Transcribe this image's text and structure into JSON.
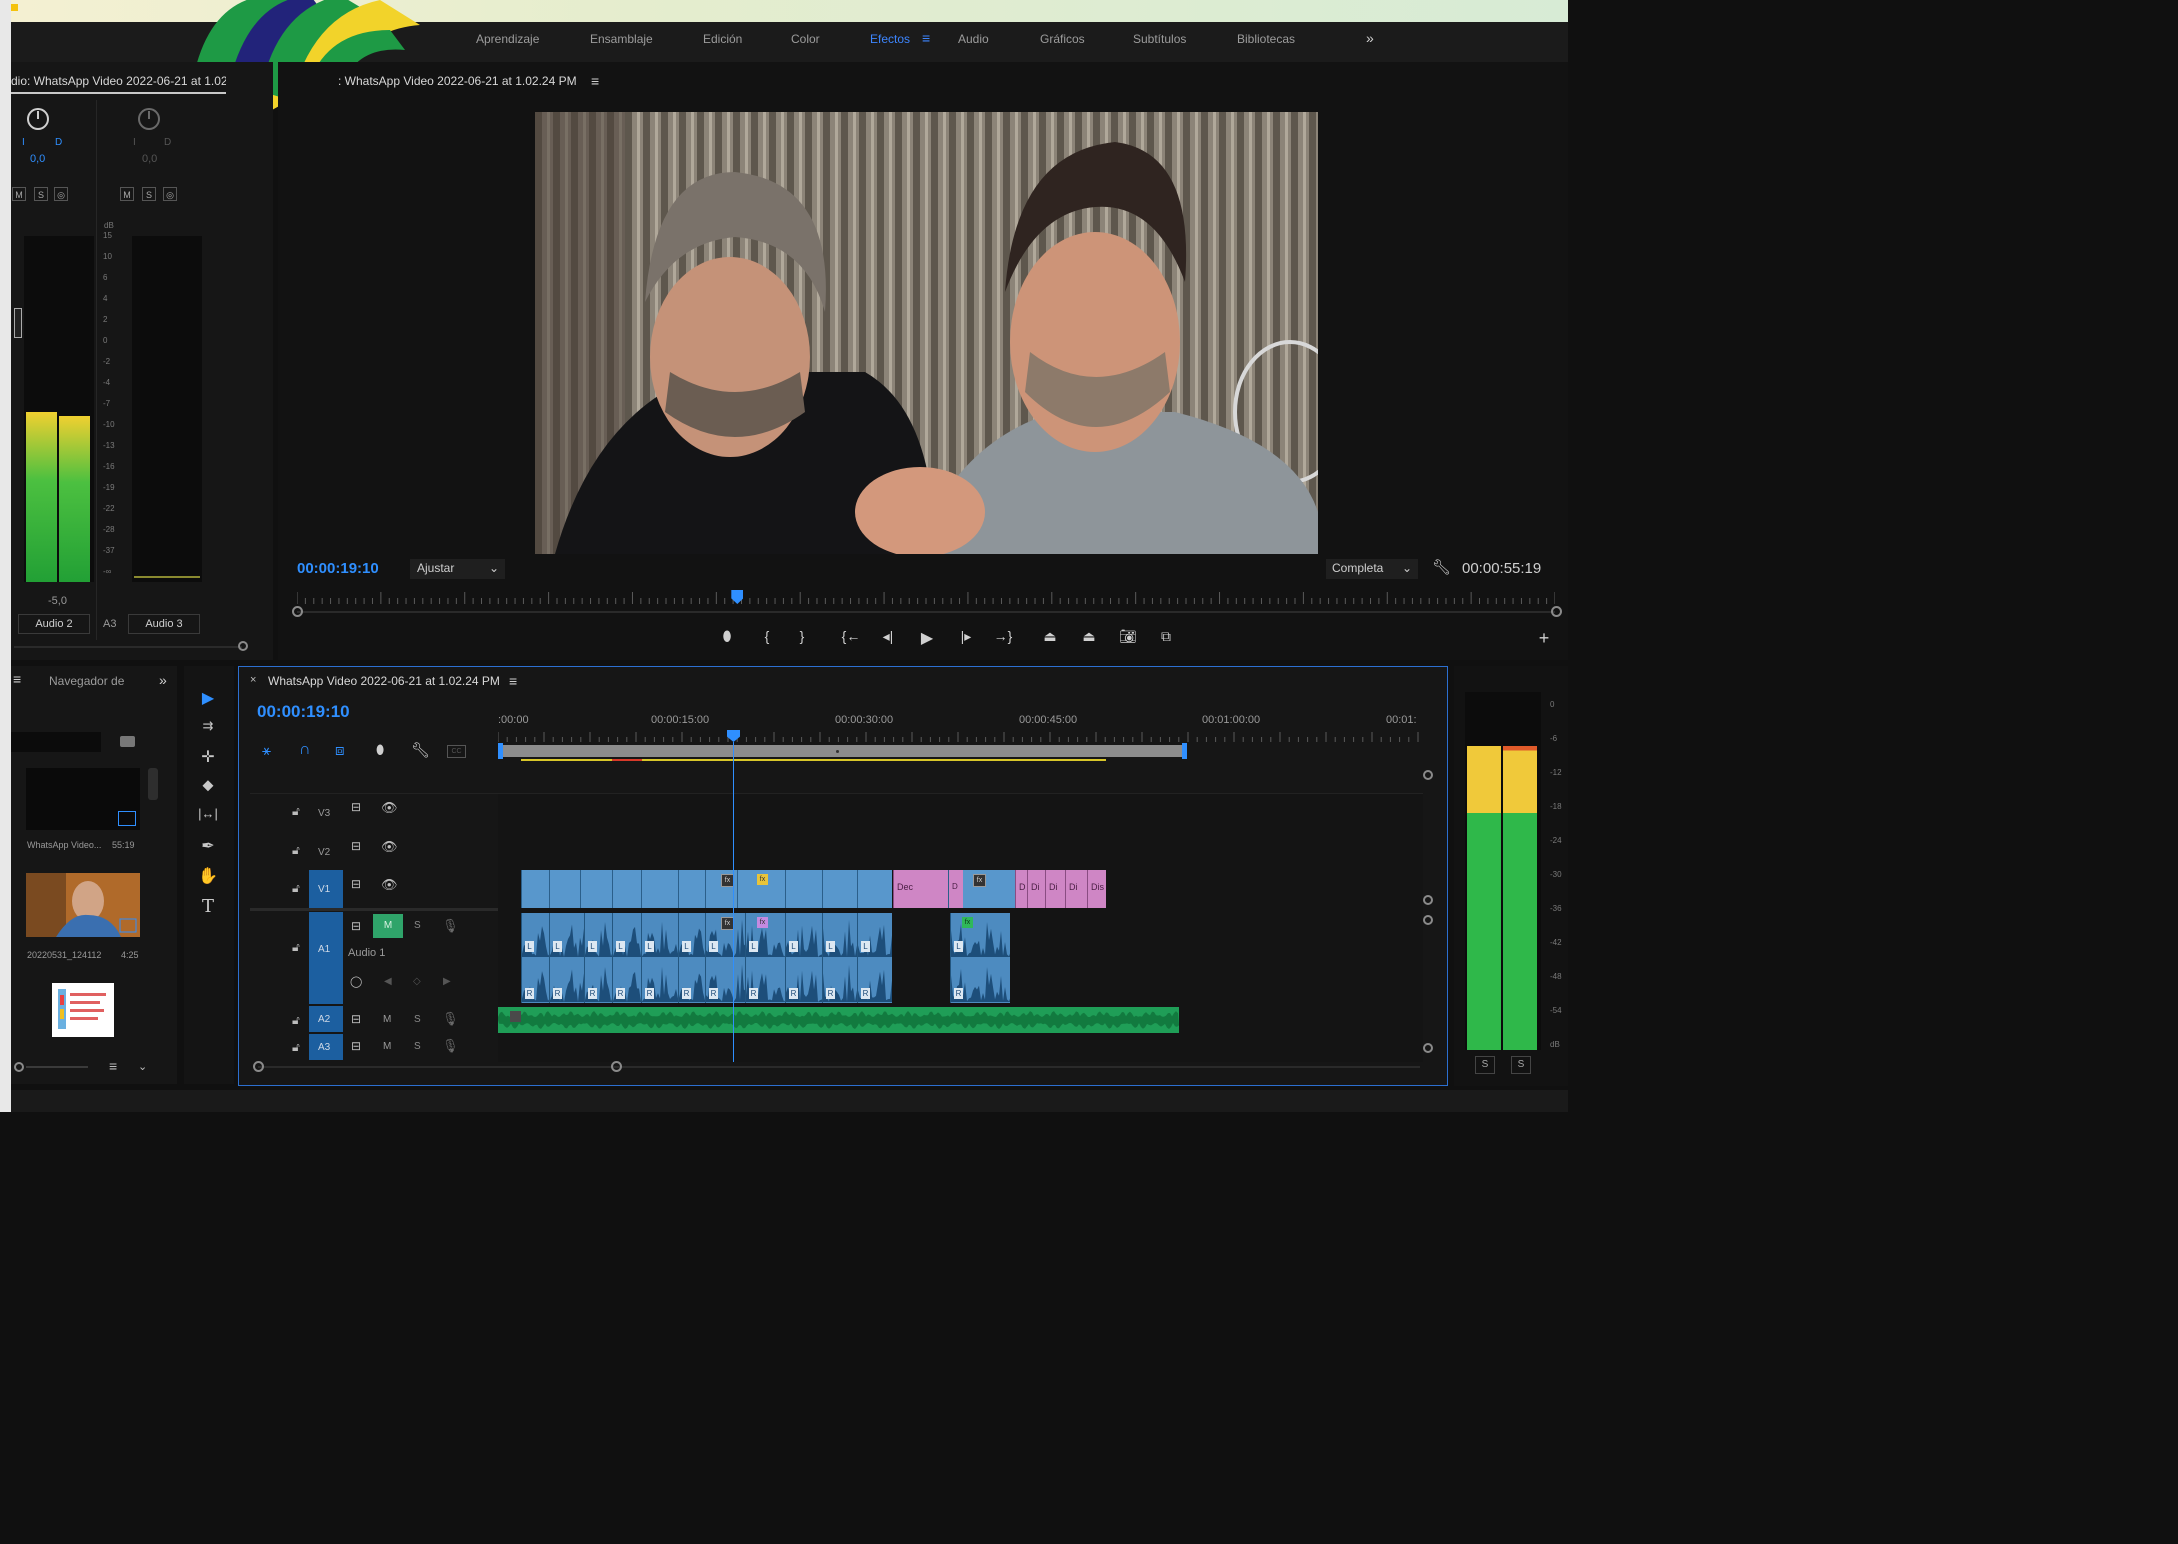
{
  "workspaces": {
    "items": [
      "Aprendizaje",
      "Ensamblaje",
      "Edición",
      "Color",
      "Efectos",
      "Audio",
      "Gráficos",
      "Subtítulos",
      "Bibliotecas"
    ],
    "active": "Efectos",
    "overflow": "»"
  },
  "mixer": {
    "tab_title": "dio: WhatsApp Video 2022-06-21 at 1.02",
    "pan_left_label": "I",
    "pan_right_label": "D",
    "pan_value_a2": "0,0",
    "pan_value_a3": "0,0",
    "btn_m": "M",
    "btn_s": "S",
    "btn_r": "◎",
    "db_unit": "dB",
    "scale": [
      "15",
      "10",
      "6",
      "4",
      "2",
      "0",
      "-2",
      "-4",
      "-7",
      "-10",
      "-13",
      "-16",
      "-19",
      "-22",
      "-28",
      "-37",
      "-∞"
    ],
    "fader_value": "-5,0",
    "ch_a2_name": "Audio 2",
    "ch_a3_id": "A3",
    "ch_a3_name": "Audio 3",
    "levels": {
      "a2_left": 0.49,
      "a2_right": 0.48,
      "a3": 0.0
    }
  },
  "program": {
    "tab_title": ": WhatsApp Video 2022-06-21 at 1.02.24 PM",
    "menu_icon": "≡",
    "timecode": "00:00:19:10",
    "zoom": "Ajustar",
    "quality": "Completa",
    "duration": "00:00:55:19",
    "playhead_position": 0.35
  },
  "project": {
    "tab_label": "Navegador de",
    "overflow": "»",
    "items": [
      {
        "name": "WhatsApp Video...",
        "duration": "55:19"
      },
      {
        "name": "20220531_124112",
        "duration": "4:25"
      }
    ]
  },
  "timeline": {
    "close": "×",
    "sequence_title": "WhatsApp Video 2022-06-21 at 1.02.24 PM",
    "timecode": "00:00:19:10",
    "ruler": [
      ":00:00",
      "00:00:15:00",
      "00:00:30:00",
      "00:00:45:00",
      "00:01:00:00",
      "00:01:"
    ],
    "tracks": {
      "v3": "V3",
      "v2": "V2",
      "v1": "V1",
      "a1": "A1",
      "a1_name": "Audio 1",
      "a2": "A2",
      "a3": "A3",
      "m": "M",
      "s": "S"
    },
    "clip_label_l": "L",
    "clip_label_r": "R",
    "fx_label": "fx",
    "pink_labels": [
      "Dec",
      "D",
      "D",
      "Di",
      "Di",
      "Di",
      "Dis"
    ]
  },
  "right_meter": {
    "scale": [
      "0",
      "-6",
      "-12",
      "-18",
      "-24",
      "-30",
      "-36",
      "-42",
      "-48",
      "-54",
      "dB"
    ],
    "solo_left": "S",
    "solo_right": "S",
    "level_left": 0.85,
    "level_right": 0.85
  },
  "colors": {
    "accent": "#2f8fff",
    "video_clip": "#5897cc",
    "audio_clip": "#4d8bc0",
    "pink_clip": "#cf86c5",
    "green_audio": "#1fa65b",
    "meter_green": "#2fb84a",
    "meter_yellow": "#f0c93a"
  }
}
